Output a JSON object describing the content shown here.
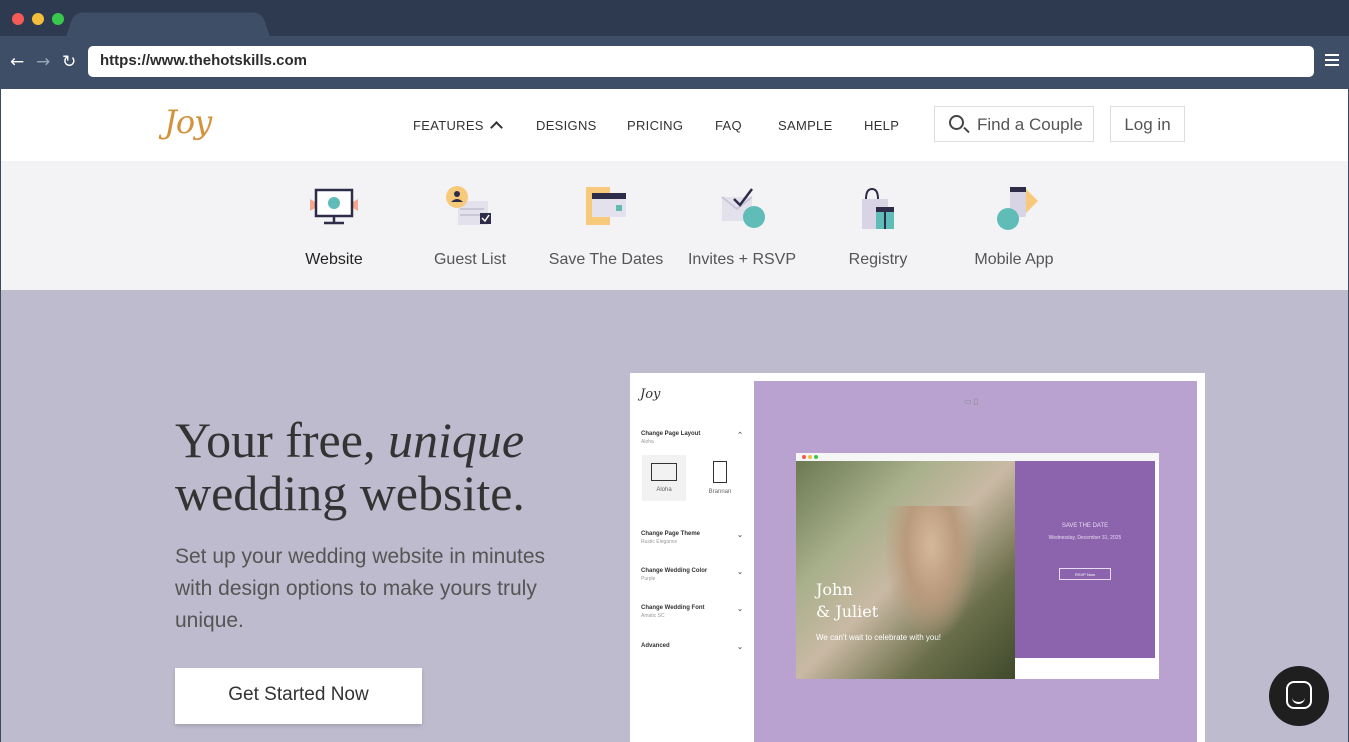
{
  "browser": {
    "url": "https://www.thehotskills.com",
    "back_icon": "←",
    "forward_icon": "→",
    "reload_icon": "↻"
  },
  "header": {
    "logo": "Joy",
    "nav": [
      "FEATURES",
      "DESIGNS",
      "PRICING",
      "FAQ",
      "SAMPLE",
      "HELP"
    ],
    "find_label": "Find a Couple",
    "login_label": "Log in"
  },
  "features": [
    {
      "label": "Website",
      "icon": "monitor-icon",
      "active": true
    },
    {
      "label": "Guest List",
      "icon": "guest-list-icon",
      "active": false
    },
    {
      "label": "Save The Dates",
      "icon": "calendar-icon",
      "active": false
    },
    {
      "label": "Invites + RSVP",
      "icon": "envelope-check-icon",
      "active": false
    },
    {
      "label": "Registry",
      "icon": "gift-bag-icon",
      "active": false
    },
    {
      "label": "Mobile App",
      "icon": "phone-icon",
      "active": false
    }
  ],
  "hero": {
    "headline_part1": "Your free, ",
    "headline_em": "unique",
    "headline_part2": "wedding website.",
    "subtext": "Set up your wedding website in minutes with design options to make yours truly unique.",
    "cta_label": "Get Started Now"
  },
  "mockup": {
    "logo": "Joy",
    "panel": [
      {
        "title": "Change Page Layout",
        "value": "Aloha"
      },
      {
        "title": "Change Page Theme",
        "value": "Rustic Elegance"
      },
      {
        "title": "Change Wedding Color",
        "value": "Purple"
      },
      {
        "title": "Change Wedding Font",
        "value": "Amatic SC"
      },
      {
        "title": "Advanced",
        "value": ""
      }
    ],
    "layouts": [
      "Aloha",
      "Brannan"
    ],
    "names_line1": "John",
    "names_line2": "& Juliet",
    "tagline": "We can't wait to celebrate with you!",
    "date_title": "SAVE THE DATE",
    "date_line": "Wednesday, December 31, 2025",
    "rsvp": "RSVP Now"
  },
  "colors": {
    "hero_bg": "#bdbbcd",
    "mock_canvas": "#b9a2cf",
    "mock_panel": "#8c63ad",
    "accent_teal": "#5fbcb7",
    "accent_gold": "#f7c97a"
  }
}
